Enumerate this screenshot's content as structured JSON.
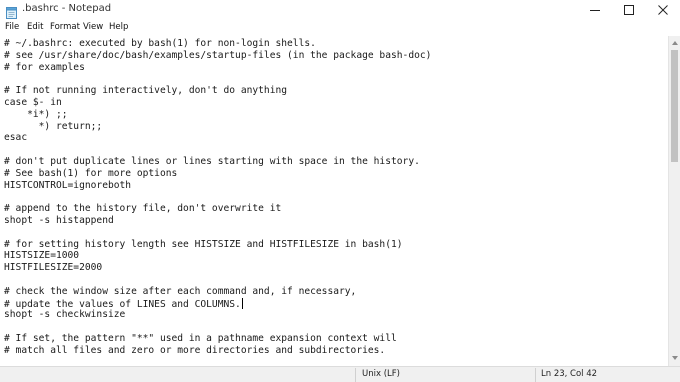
{
  "window": {
    "title": ".bashrc - Notepad",
    "icon": "notepad-icon",
    "controls": [
      "minimize-icon",
      "maximize-icon",
      "close-icon"
    ]
  },
  "menu": {
    "items": [
      "File",
      "Edit",
      "Format",
      "View",
      "Help"
    ]
  },
  "editor": {
    "lines": [
      "# ~/.bashrc: executed by bash(1) for non-login shells.",
      "# see /usr/share/doc/bash/examples/startup-files (in the package bash-doc)",
      "# for examples",
      "",
      "# If not running interactively, don't do anything",
      "case $- in",
      "    *i*) ;;",
      "      *) return;;",
      "esac",
      "",
      "# don't put duplicate lines or lines starting with space in the history.",
      "# See bash(1) for more options",
      "HISTCONTROL=ignoreboth",
      "",
      "# append to the history file, don't overwrite it",
      "shopt -s histappend",
      "",
      "# for setting history length see HISTSIZE and HISTFILESIZE in bash(1)",
      "HISTSIZE=1000",
      "HISTFILESIZE=2000",
      "",
      "# check the window size after each command and, if necessary,",
      "# update the values of LINES and COLUMNS.",
      "shopt -s checkwinsize",
      "",
      "# If set, the pattern \"**\" used in a pathname expansion context will",
      "# match all files and zero or more directories and subdirectories."
    ],
    "caret_line": 23
  },
  "status": {
    "line_ending": "Unix (LF)",
    "position": "Ln 23, Col 42"
  },
  "colors": {
    "status_bg": "#f0f0f0",
    "scroll_thumb": "#c2c2c2",
    "text": "#1a1a1a"
  }
}
